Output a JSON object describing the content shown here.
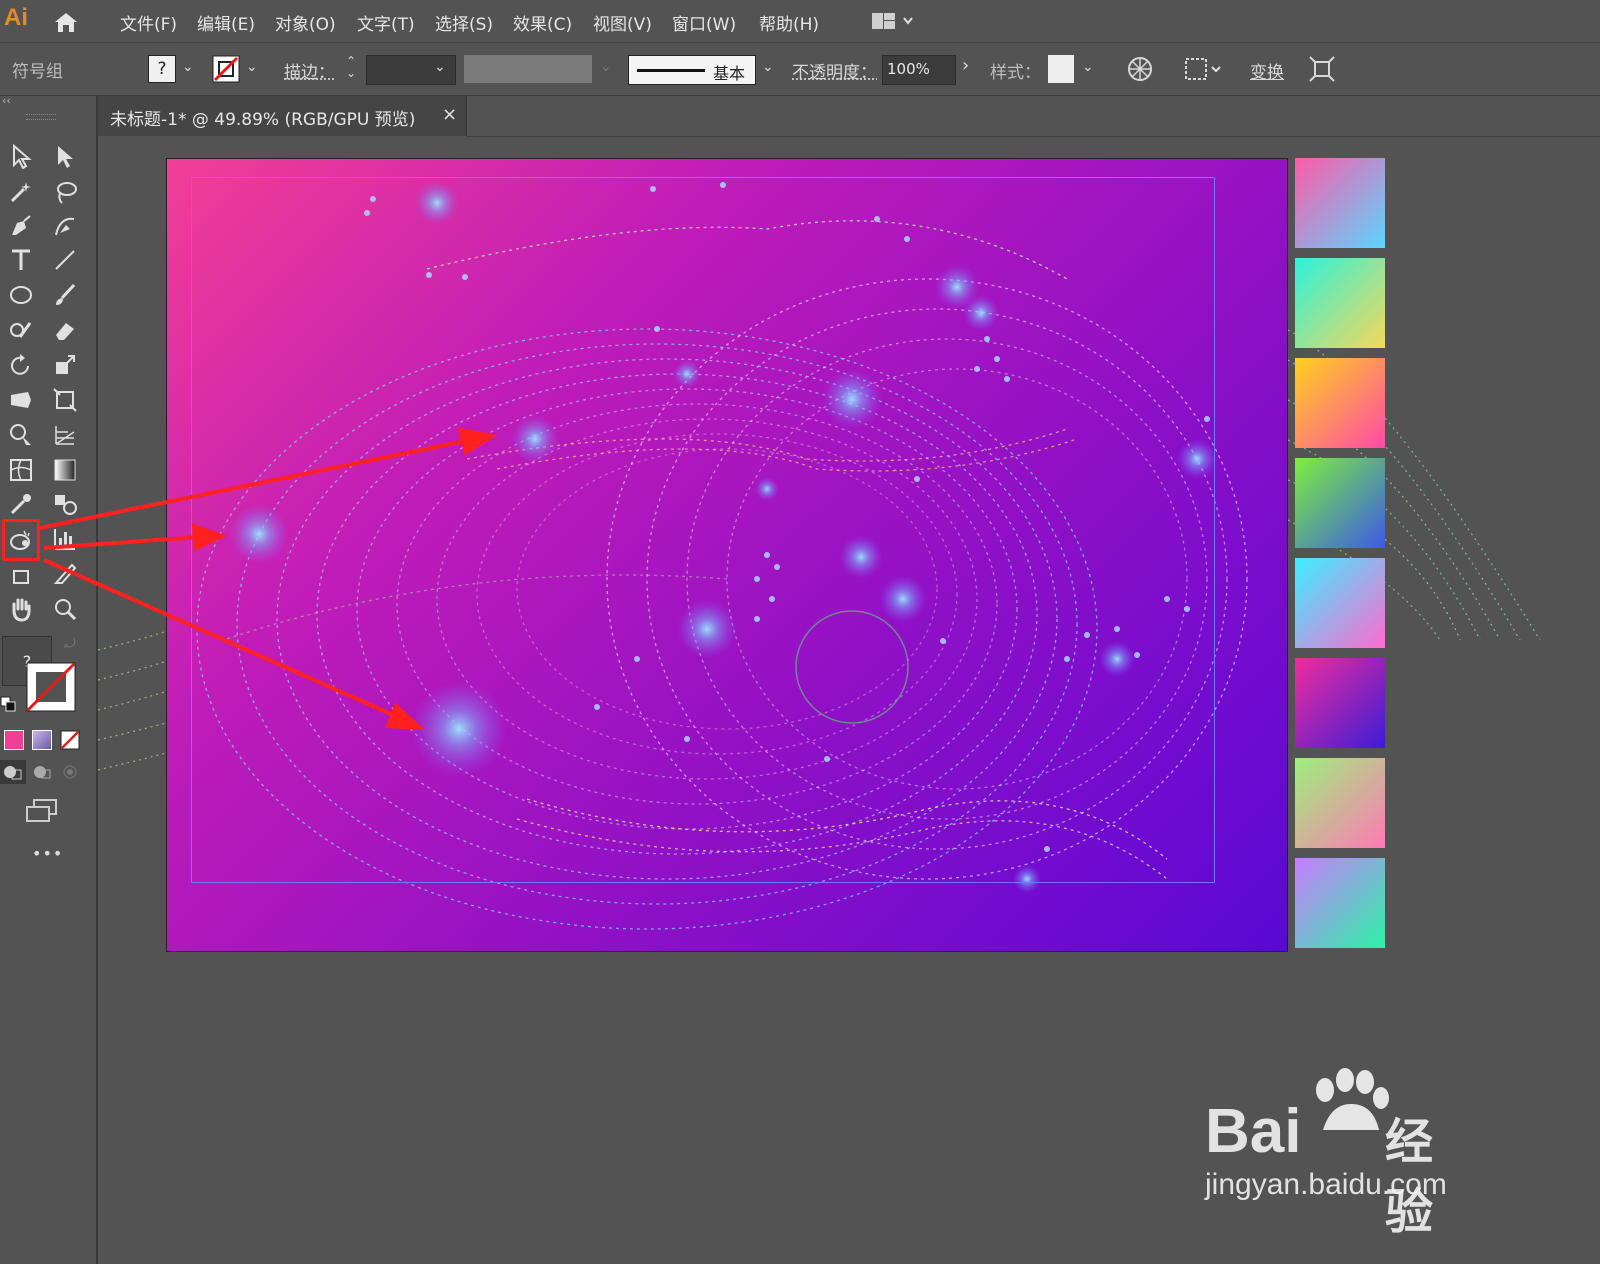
{
  "app": {
    "logo": "Ai"
  },
  "menu": {
    "items": [
      "文件(F)",
      "编辑(E)",
      "对象(O)",
      "文字(T)",
      "选择(S)",
      "效果(C)",
      "视图(V)",
      "窗口(W)",
      "帮助(H)"
    ]
  },
  "control": {
    "selection_label": "符号组",
    "fill_value": "?",
    "stroke_label": "描边：",
    "brush_label": "基本",
    "opacity_label": "不透明度：",
    "opacity_value": "100%",
    "style_label": "样式：",
    "transform_label": "变换"
  },
  "document": {
    "tab_title": "未标题-1* @ 49.89% (RGB/GPU 预览)",
    "close_glyph": "×"
  },
  "toolbar": {
    "fill_unknown": "?",
    "more": "•••",
    "highlighted_tool": "symbol-sprayer-tool"
  },
  "swatches": [
    {
      "from": "#ff5aa8",
      "to": "#5ad6ff"
    },
    {
      "from": "#2cf2dc",
      "to": "#f6d85a"
    },
    {
      "from": "#ffd21c",
      "to": "#ff4aa8"
    },
    {
      "from": "#7cf03c",
      "to": "#3c5ae6"
    },
    {
      "from": "#3cf0ff",
      "to": "#ff6ad0"
    },
    {
      "from": "#f02c9c",
      "to": "#3c1cd6"
    },
    {
      "from": "#9cf07c",
      "to": "#ff7ab4"
    },
    {
      "from": "#c87cff",
      "to": "#2cf2a6"
    }
  ],
  "colors": {
    "annotation_red": "#ff2020",
    "artboard_start": "#f23f95",
    "artboard_end": "#5a08d6"
  },
  "watermark": {
    "brand": "Bai",
    "brand_suffix": "经验",
    "url": "jingyan.baidu.com"
  }
}
